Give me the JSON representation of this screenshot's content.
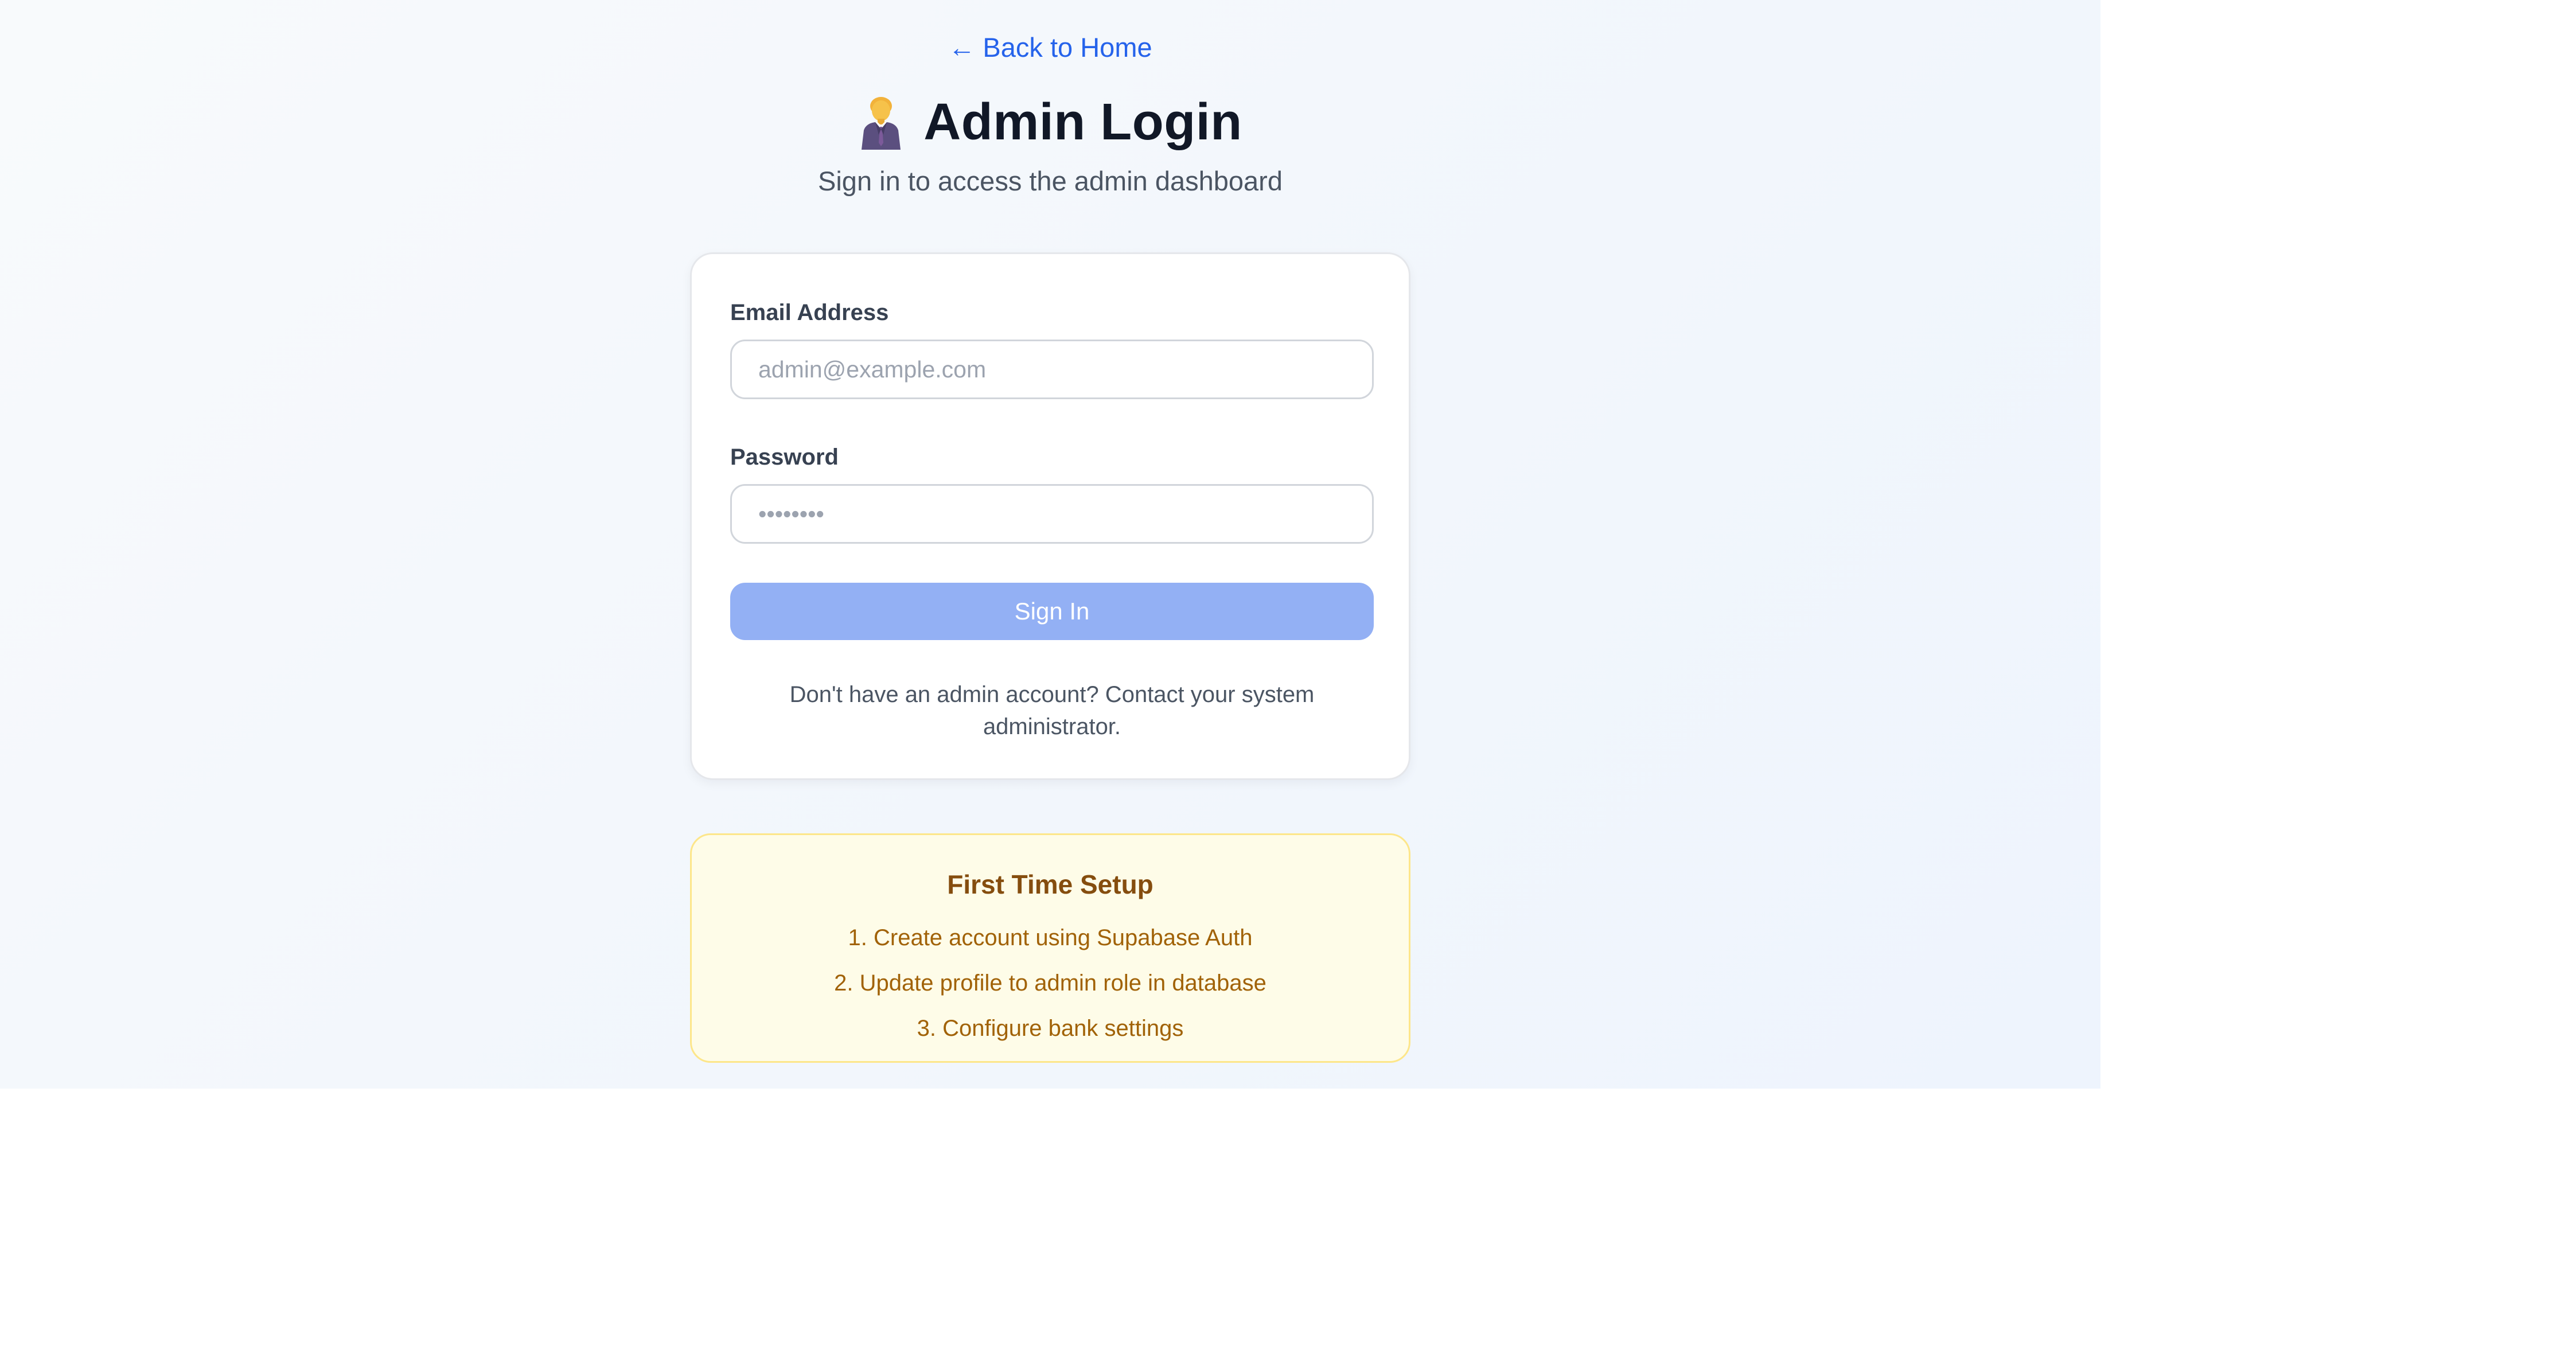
{
  "nav": {
    "back_label": "← Back to Home"
  },
  "header": {
    "icon": "businessman-emoji-icon",
    "title": "Admin Login",
    "subtitle": "Sign in to access the admin dashboard"
  },
  "form": {
    "email_label": "Email Address",
    "email_value": "",
    "email_placeholder": "admin@example.com",
    "password_label": "Password",
    "password_value": "",
    "password_placeholder": "••••••••",
    "submit_label": "Sign In",
    "help_text": "Don't have an admin account? Contact your system administrator."
  },
  "setup": {
    "title": "First Time Setup",
    "steps": [
      "1. Create account using Supabase Auth",
      "2. Update profile to admin role in database",
      "3. Configure bank settings"
    ]
  },
  "colors": {
    "link": "#2563eb",
    "button_disabled": "#93b0f4",
    "setup_bg": "#fefce8",
    "setup_title": "#854d0e",
    "setup_text": "#a16207"
  }
}
